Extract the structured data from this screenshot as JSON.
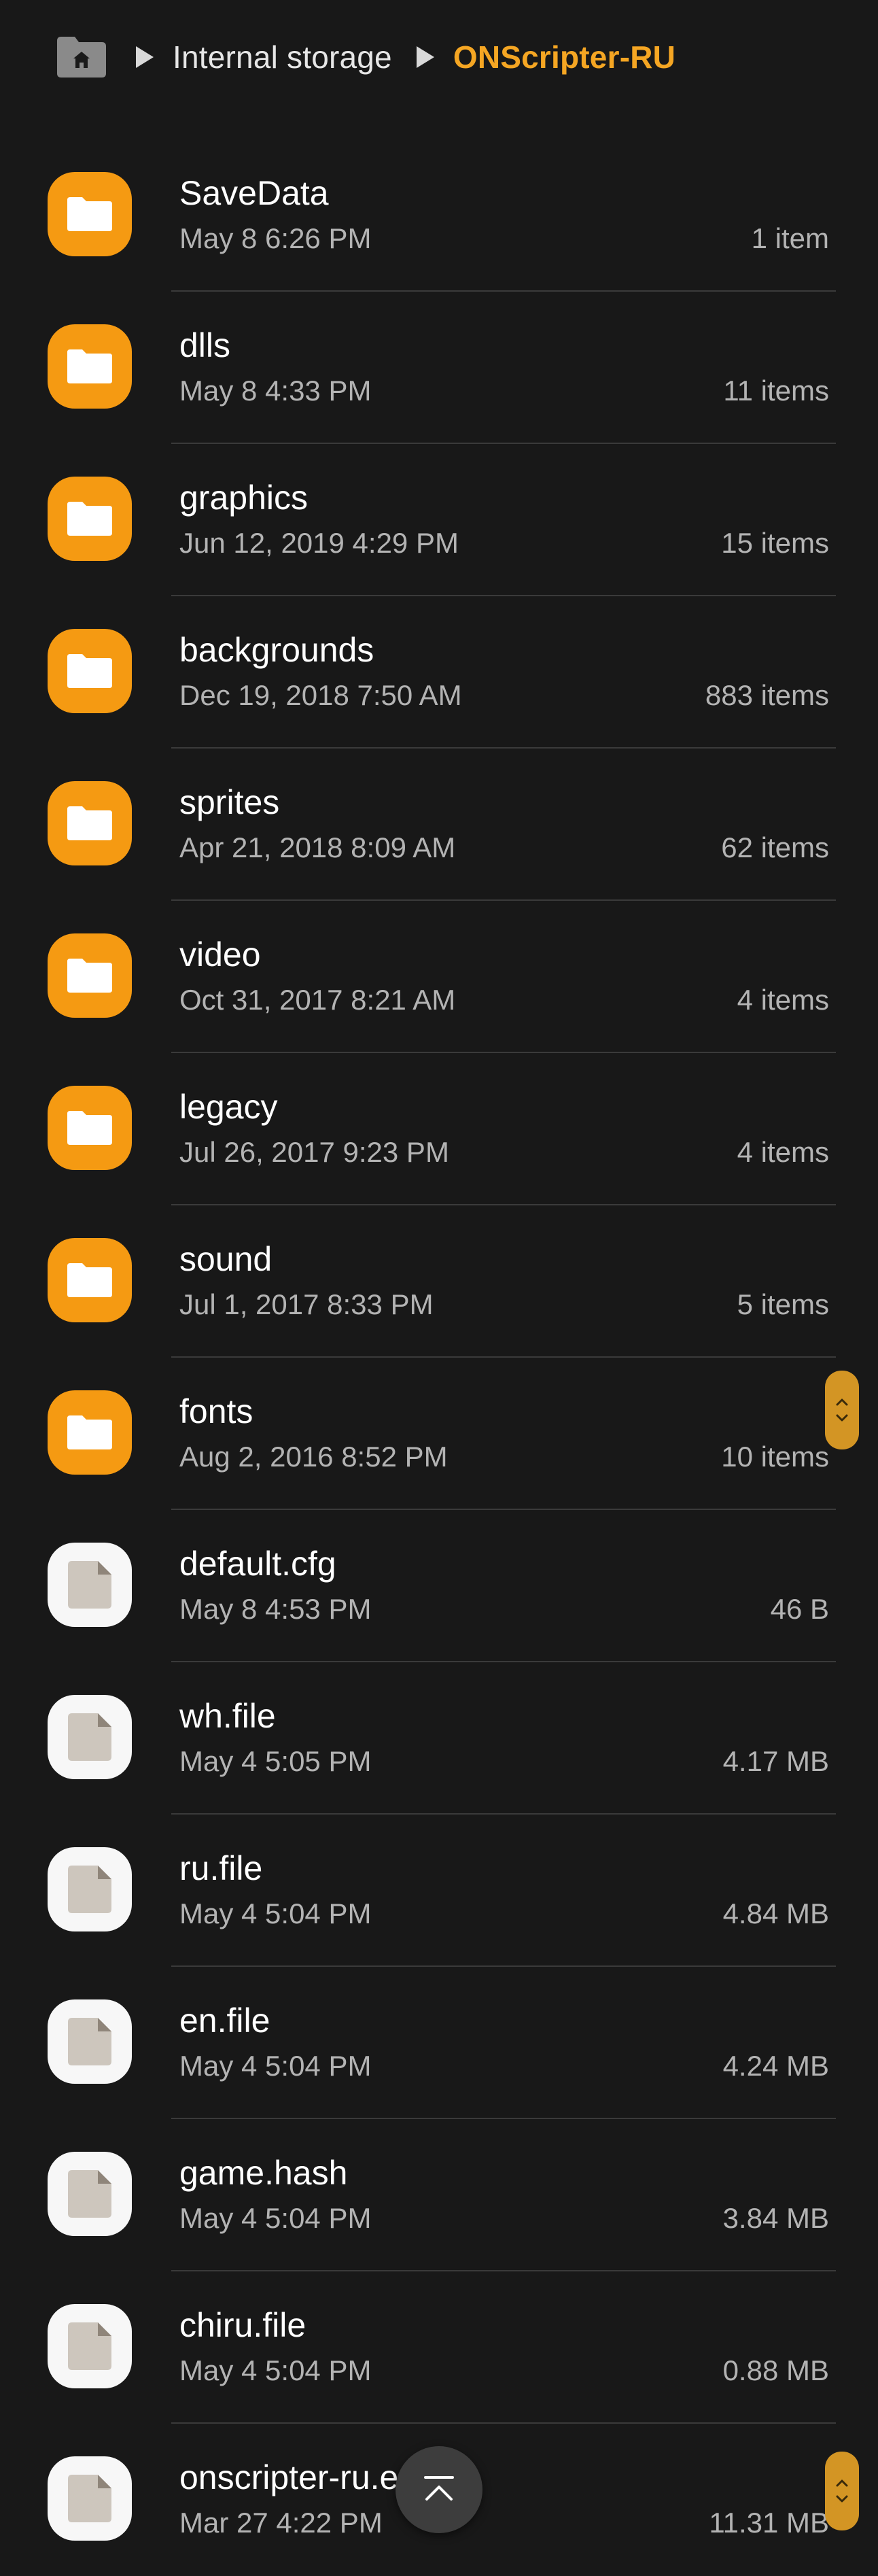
{
  "breadcrumb": {
    "items": [
      "Internal storage",
      "ONScripter-RU"
    ]
  },
  "colors": {
    "accent": "#f5a623",
    "folder": "#f59a12",
    "background": "#181818"
  },
  "icons": {
    "home": "home-folder-icon",
    "folder": "folder-icon",
    "file": "file-icon",
    "scroll_top": "chevron-up-icon"
  },
  "files": [
    {
      "name": "SaveData",
      "date": "May 8 6:26 PM",
      "meta": "1 item",
      "type": "folder"
    },
    {
      "name": "dlls",
      "date": "May 8 4:33 PM",
      "meta": "11 items",
      "type": "folder"
    },
    {
      "name": "graphics",
      "date": "Jun 12, 2019 4:29 PM",
      "meta": "15 items",
      "type": "folder"
    },
    {
      "name": "backgrounds",
      "date": "Dec 19, 2018 7:50 AM",
      "meta": "883 items",
      "type": "folder"
    },
    {
      "name": "sprites",
      "date": "Apr 21, 2018 8:09 AM",
      "meta": "62 items",
      "type": "folder"
    },
    {
      "name": "video",
      "date": "Oct 31, 2017 8:21 AM",
      "meta": "4 items",
      "type": "folder"
    },
    {
      "name": "legacy",
      "date": "Jul 26, 2017 9:23 PM",
      "meta": "4 items",
      "type": "folder"
    },
    {
      "name": "sound",
      "date": "Jul 1, 2017 8:33 PM",
      "meta": "5 items",
      "type": "folder"
    },
    {
      "name": "fonts",
      "date": "Aug 2, 2016 8:52 PM",
      "meta": "10 items",
      "type": "folder"
    },
    {
      "name": "default.cfg",
      "date": "May 8 4:53 PM",
      "meta": "46 B",
      "type": "file"
    },
    {
      "name": "wh.file",
      "date": "May 4 5:05 PM",
      "meta": "4.17 MB",
      "type": "file"
    },
    {
      "name": "ru.file",
      "date": "May 4 5:04 PM",
      "meta": "4.84 MB",
      "type": "file"
    },
    {
      "name": "en.file",
      "date": "May 4 5:04 PM",
      "meta": "4.24 MB",
      "type": "file"
    },
    {
      "name": "game.hash",
      "date": "May 4 5:04 PM",
      "meta": "3.84 MB",
      "type": "file"
    },
    {
      "name": "chiru.file",
      "date": "May 4 5:04 PM",
      "meta": "0.88 MB",
      "type": "file"
    },
    {
      "name": "onscripter-ru.e",
      "date": "Mar 27 4:22 PM",
      "meta": "11.31 MB",
      "type": "file"
    }
  ]
}
